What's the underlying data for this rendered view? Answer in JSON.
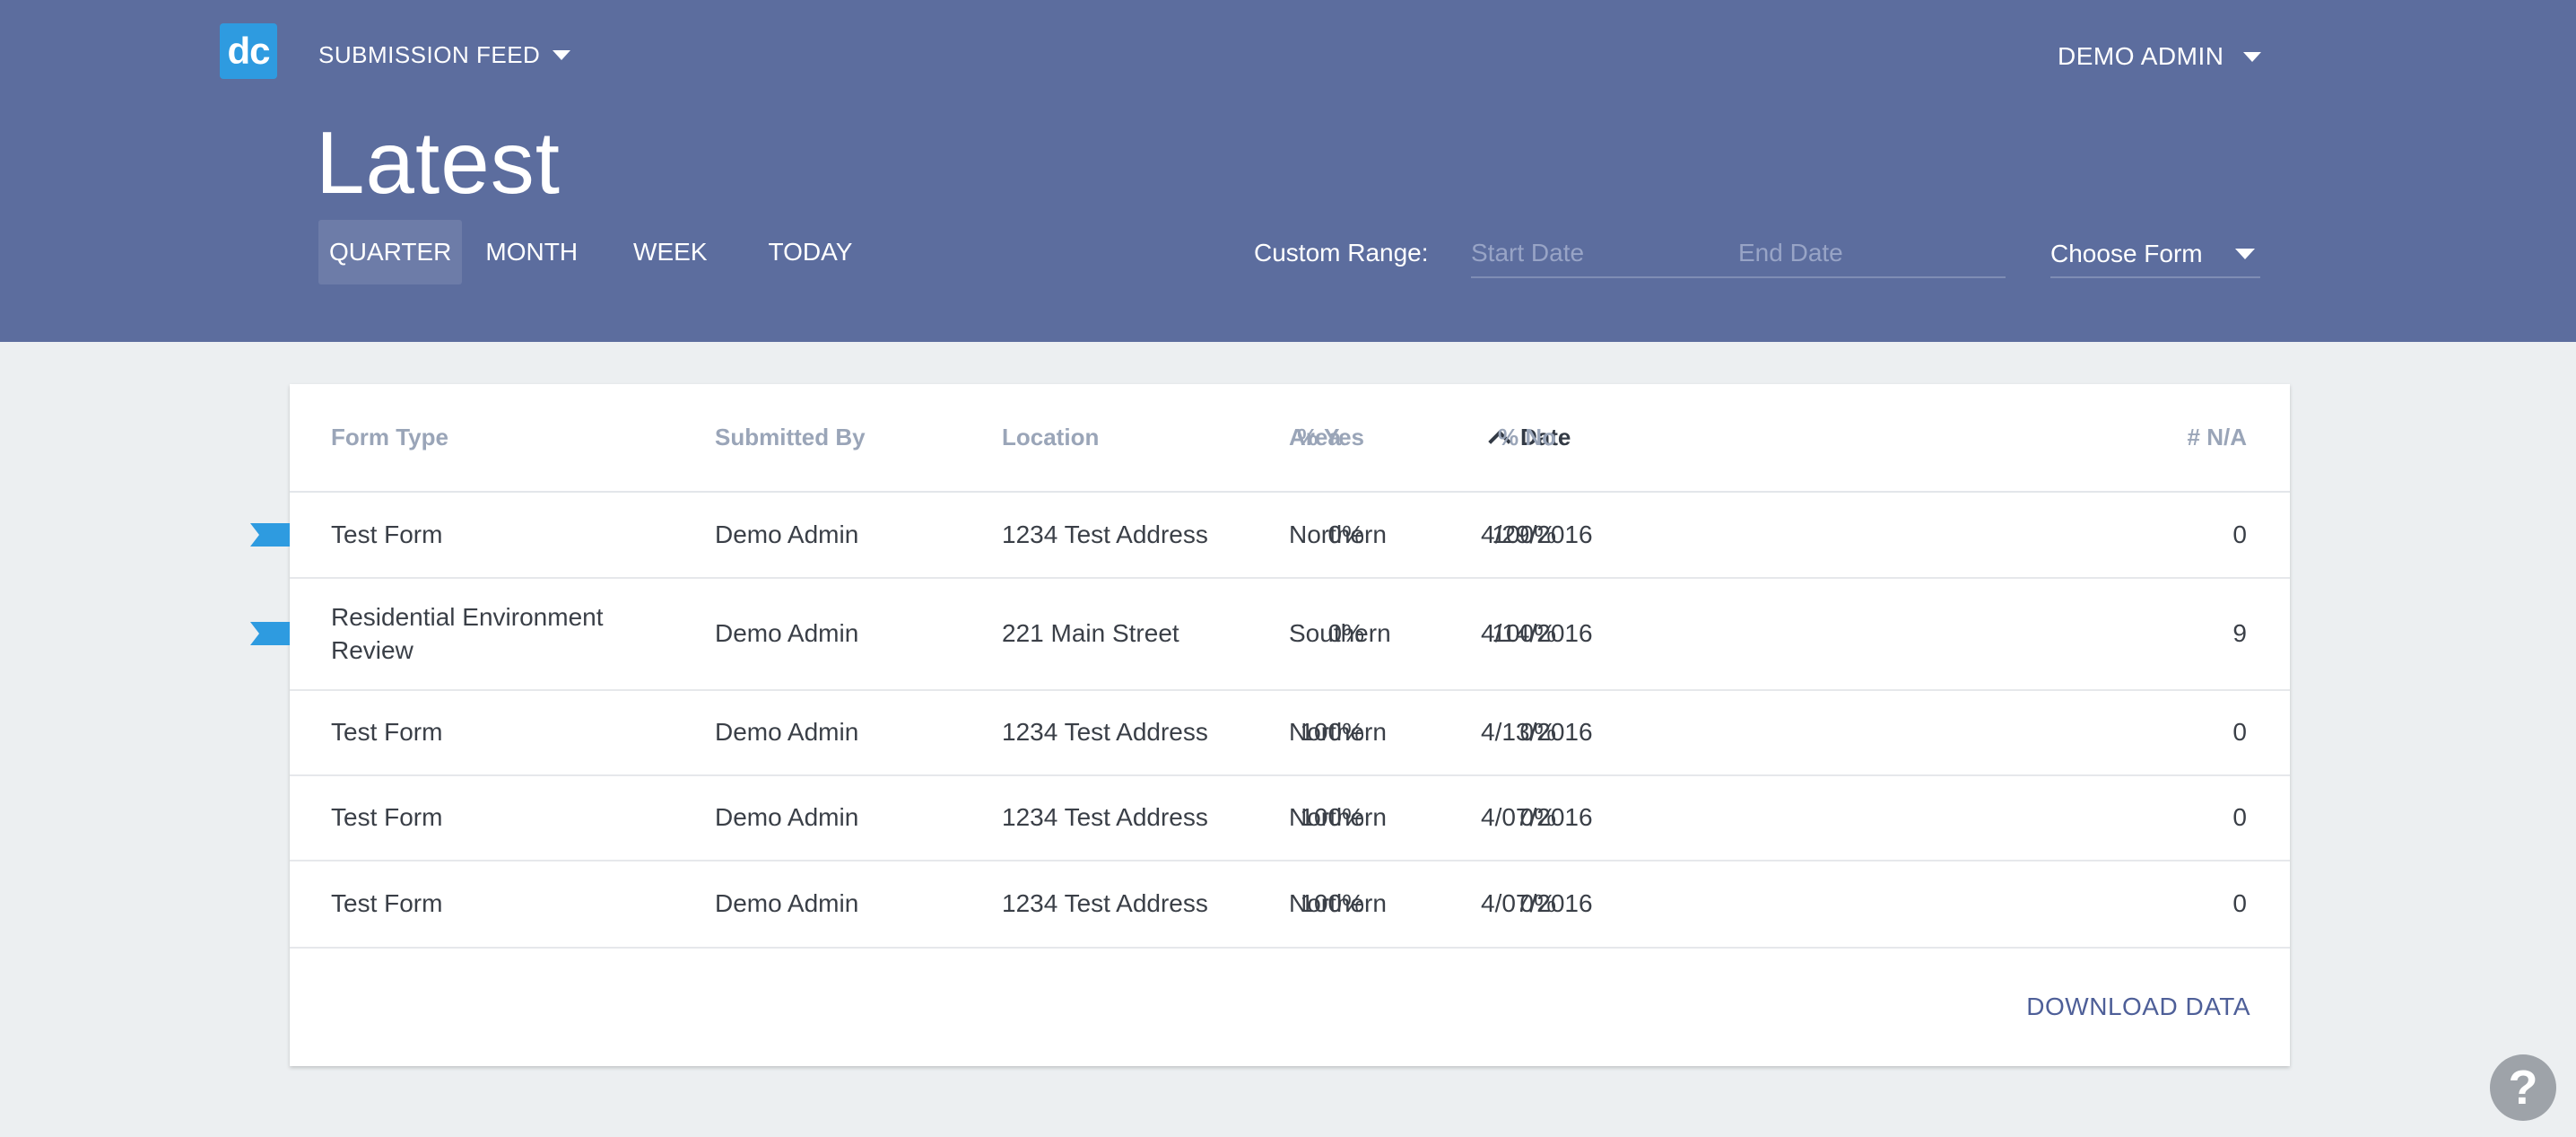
{
  "header": {
    "logo_text": "dc",
    "nav_label": "SUBMISSION FEED",
    "user_label": "DEMO ADMIN",
    "page_title": "Latest",
    "range_tabs": [
      "QUARTER",
      "MONTH",
      "WEEK",
      "TODAY"
    ],
    "active_tab": "QUARTER",
    "custom_range_label": "Custom Range:",
    "start_date_placeholder": "Start Date",
    "end_date_placeholder": "End Date",
    "form_select_label": "Choose Form",
    "colors": {
      "header_bg": "#5c6d9e",
      "logo_bg": "#2e9be0",
      "flag": "#2e9be0"
    }
  },
  "table": {
    "columns": [
      "Form Type",
      "Submitted By",
      "Location",
      "Area",
      "Date",
      "% Yes",
      "% No",
      "# N/A"
    ],
    "sorted_column": "Date",
    "sort_direction": "ascending",
    "rows": [
      {
        "form_type": "Test Form",
        "submitted_by": "Demo Admin",
        "location": "1234 Test Address",
        "area": "Northern",
        "date": "4/29/2016",
        "yes": "0%",
        "no": "100%",
        "na": "0",
        "flagged": true
      },
      {
        "form_type": "Residential Environment Review",
        "submitted_by": "Demo Admin",
        "location": "221 Main Street",
        "area": "Southern",
        "date": "4/14/2016",
        "yes": "0%",
        "no": "100%",
        "na": "9",
        "flagged": true
      },
      {
        "form_type": "Test Form",
        "submitted_by": "Demo Admin",
        "location": "1234 Test Address",
        "area": "Northern",
        "date": "4/13/2016",
        "yes": "100%",
        "no": "0%",
        "na": "0",
        "flagged": false
      },
      {
        "form_type": "Test Form",
        "submitted_by": "Demo Admin",
        "location": "1234 Test Address",
        "area": "Northern",
        "date": "4/07/2016",
        "yes": "100%",
        "no": "0%",
        "na": "0",
        "flagged": false
      },
      {
        "form_type": "Test Form",
        "submitted_by": "Demo Admin",
        "location": "1234 Test Address",
        "area": "Northern",
        "date": "4/07/2016",
        "yes": "100%",
        "no": "0%",
        "na": "0",
        "flagged": false
      }
    ],
    "download_label": "DOWNLOAD DATA"
  },
  "help": {
    "icon": "question-mark-icon",
    "glyph": "?"
  }
}
